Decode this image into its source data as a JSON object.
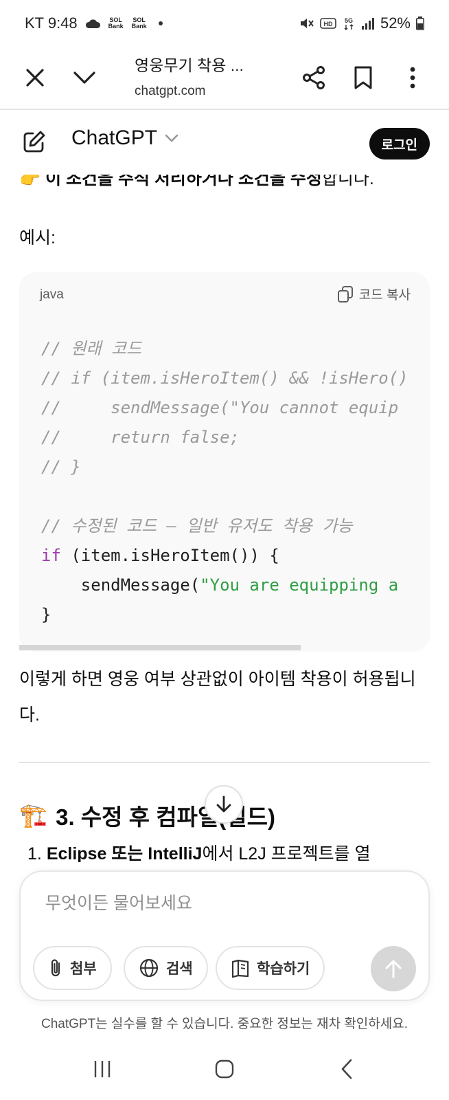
{
  "status_bar": {
    "carrier_time": "KT 9:48",
    "bank_label_1": "Bank",
    "bank_label_2": "Bank",
    "battery": "52%"
  },
  "browser": {
    "tab_title": "영웅무기 착용 ...",
    "domain": "chatgpt.com"
  },
  "header": {
    "model_name": "ChatGPT",
    "login_label": "로그인"
  },
  "content": {
    "cut_line_bold": "이 조건을 주석 처리하거나 조건을 수정",
    "cut_line_rest": "합니다.",
    "example_label": "예시:",
    "code": {
      "language": "java",
      "copy_label": "코드 복사",
      "lines": [
        "// 원래 코드",
        "// if (item.isHeroItem() && !isHero()",
        "//     sendMessage(\"You cannot equip",
        "//     return false;",
        "// }",
        "",
        "// 수정된 코드 — 일반 유저도 착용 가능",
        "if",
        " (item.isHeroItem()) {",
        "    sendMessage(",
        "\"You are equipping a",
        "}"
      ]
    },
    "paragraph": "이렇게 하면 영웅 여부 상관없이 아이템 착용이 허용됩니다.",
    "section_heading": "3. 수정 후 컴파일(빌드)",
    "list_number": "1.",
    "list_item_bold": "Eclipse 또는 IntelliJ",
    "list_item_rest": "에서 L2J 프로젝트를 열"
  },
  "composer": {
    "placeholder": "무엇이든 물어보세요",
    "attach_label": "첨부",
    "search_label": "검색",
    "study_label": "학습하기"
  },
  "disclaimer": "ChatGPT는 실수를 할 수 있습니다. 중요한 정보는 재차 확인하세요.",
  "colors": {
    "code_comment": "#9a9a9a",
    "code_keyword": "#9d3cad",
    "code_string": "#2f9e44",
    "login_bg": "#0d0d0d"
  }
}
